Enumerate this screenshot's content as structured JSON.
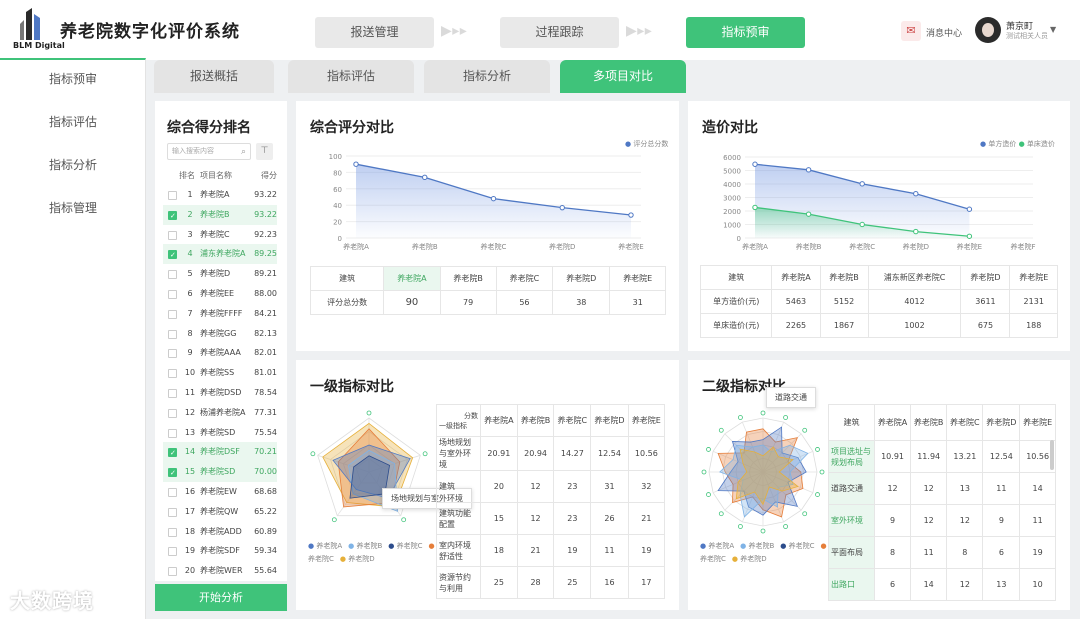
{
  "header": {
    "app_title": "养老院数字化评价系统",
    "logo_text": "BLM Digital",
    "steps": [
      "报送管理",
      "过程跟踪",
      "指标预审"
    ],
    "message_center": "消息中心",
    "user_name": "萧京町",
    "user_role": "测试相关人员"
  },
  "sidebar": {
    "items": [
      "指标预审",
      "指标评估",
      "指标分析",
      "指标管理"
    ]
  },
  "tabs": [
    "报送概括",
    "指标评估",
    "指标分析",
    "多项目对比"
  ],
  "ranking": {
    "title": "综合得分排名",
    "search_placeholder": "输入搜索内容",
    "headers": [
      "排名",
      "项目名称",
      "得分"
    ],
    "rows": [
      {
        "rank": "1",
        "name": "养老院A",
        "score": "93.22",
        "checked": false
      },
      {
        "rank": "2",
        "name": "养老院B",
        "score": "93.22",
        "checked": true
      },
      {
        "rank": "3",
        "name": "养老院C",
        "score": "92.23",
        "checked": false
      },
      {
        "rank": "4",
        "name": "浦东养老院A",
        "score": "89.25",
        "checked": true
      },
      {
        "rank": "5",
        "name": "养老院D",
        "score": "89.21",
        "checked": false
      },
      {
        "rank": "6",
        "name": "养老院EE",
        "score": "88.00",
        "checked": false
      },
      {
        "rank": "7",
        "name": "养老院FFFF",
        "score": "84.21",
        "checked": false
      },
      {
        "rank": "8",
        "name": "养老院GG",
        "score": "82.13",
        "checked": false
      },
      {
        "rank": "9",
        "name": "养老院AAA",
        "score": "82.01",
        "checked": false
      },
      {
        "rank": "10",
        "name": "养老院SS",
        "score": "81.01",
        "checked": false
      },
      {
        "rank": "11",
        "name": "养老院DSD",
        "score": "78.54",
        "checked": false
      },
      {
        "rank": "12",
        "name": "杨浦养老院A",
        "score": "77.31",
        "checked": false
      },
      {
        "rank": "13",
        "name": "养老院SD",
        "score": "75.54",
        "checked": false
      },
      {
        "rank": "14",
        "name": "养老院DSF",
        "score": "70.21",
        "checked": true
      },
      {
        "rank": "15",
        "name": "养老院SD",
        "score": "70.00",
        "checked": true
      },
      {
        "rank": "16",
        "name": "养老院EW",
        "score": "68.68",
        "checked": false
      },
      {
        "rank": "17",
        "name": "养老院QW",
        "score": "65.22",
        "checked": false
      },
      {
        "rank": "18",
        "name": "养老院ADD",
        "score": "60.89",
        "checked": false
      },
      {
        "rank": "19",
        "name": "养老院SDF",
        "score": "59.34",
        "checked": false
      },
      {
        "rank": "20",
        "name": "养老院WER",
        "score": "55.64",
        "checked": false
      }
    ],
    "start_button": "开始分析"
  },
  "score_compare": {
    "title": "综合评分对比",
    "table_header": [
      "建筑",
      "养老院A",
      "养老院B",
      "养老院C",
      "养老院D",
      "养老院E"
    ],
    "table_row": [
      "评分总分数",
      "90",
      "79",
      "56",
      "38",
      "31"
    ]
  },
  "cost_compare": {
    "title": "造价对比",
    "table_header": [
      "建筑",
      "养老院A",
      "养老院B",
      "浦东新区养老院C",
      "养老院D",
      "养老院E"
    ],
    "table_rows": [
      [
        "单方造价(元)",
        "5463",
        "5152",
        "4012",
        "3611",
        "2131"
      ],
      [
        "单床造价(元)",
        "2265",
        "1867",
        "1002",
        "675",
        "188"
      ]
    ]
  },
  "level1": {
    "title": "一级指标对比",
    "tooltip": "场地规划与室外环境",
    "corner_top": "分数",
    "corner_bottom": "一级指标",
    "cols": [
      "养老院A",
      "养老院B",
      "养老院C",
      "养老院D",
      "养老院E"
    ],
    "rows": [
      [
        "场地规划与室外环境",
        "20.91",
        "20.94",
        "14.27",
        "12.54",
        "10.56"
      ],
      [
        "建筑",
        "20",
        "12",
        "23",
        "31",
        "32"
      ],
      [
        "建筑功能配置",
        "15",
        "12",
        "23",
        "26",
        "21"
      ],
      [
        "室内环境舒适性",
        "18",
        "21",
        "19",
        "11",
        "19"
      ],
      [
        "资源节约与利用",
        "25",
        "28",
        "25",
        "16",
        "17"
      ]
    ],
    "legend": [
      "养老院A",
      "养老院B",
      "养老院C",
      "养老院C",
      "养老院D"
    ]
  },
  "level2": {
    "title": "二级指标对比",
    "tooltip": "道路交通",
    "corner": "建筑",
    "cols": [
      "养老院A",
      "养老院B",
      "养老院C",
      "养老院D",
      "养老院E"
    ],
    "rows": [
      [
        "项目选址与规划布局",
        "10.91",
        "11.94",
        "13.21",
        "12.54",
        "10.56"
      ],
      [
        "道路交通",
        "12",
        "12",
        "13",
        "11",
        "14"
      ],
      [
        "室外环境",
        "9",
        "12",
        "12",
        "9",
        "11"
      ],
      [
        "平面布局",
        "8",
        "11",
        "8",
        "6",
        "19"
      ],
      [
        "出路口",
        "6",
        "14",
        "12",
        "13",
        "10"
      ]
    ],
    "legend": [
      "养老院A",
      "养老院B",
      "养老院C",
      "养老院C",
      "养老院D"
    ]
  },
  "watermark": "大数跨境",
  "colors": {
    "accent": "#3fc37a",
    "blue": "#4f78c4",
    "green": "#3fc37a"
  },
  "chart_data": [
    {
      "type": "line",
      "x": [
        "养老院A",
        "养老院B",
        "养老院C",
        "养老院D",
        "养老院E"
      ],
      "series": [
        {
          "name": "评分总分数",
          "values": [
            90,
            74,
            48,
            37,
            28
          ]
        }
      ],
      "ylim": [
        0,
        100
      ],
      "yticks": [
        0,
        20,
        40,
        60,
        80,
        100
      ],
      "legend": "top-right"
    },
    {
      "type": "line",
      "x": [
        "养老院A",
        "养老院B",
        "养老院C",
        "养老院D",
        "养老院E",
        "养老院F"
      ],
      "series": [
        {
          "name": "单方造价",
          "values": [
            5463,
            5050,
            4012,
            3280,
            2131
          ]
        },
        {
          "name": "单床造价",
          "values": [
            2265,
            1767,
            1002,
            475,
            128
          ]
        }
      ],
      "ylim": [
        0,
        6000
      ],
      "yticks": [
        0,
        1000,
        2000,
        3000,
        4000,
        5000,
        6000
      ],
      "legend": "top-right"
    }
  ]
}
